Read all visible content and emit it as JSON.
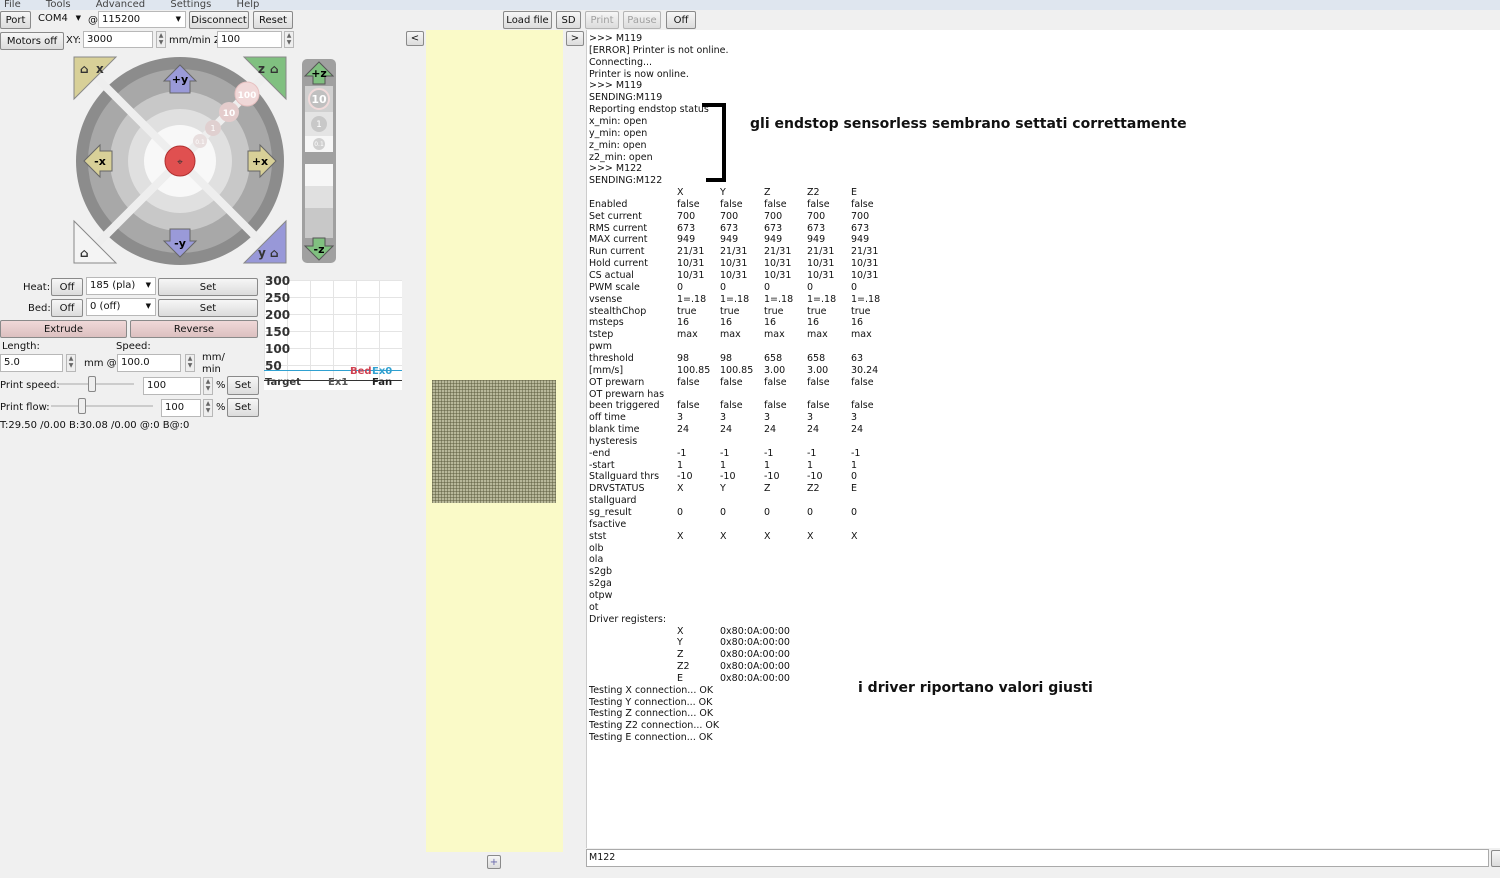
{
  "menu": [
    "File",
    "Tools",
    "Advanced",
    "Settings",
    "Help"
  ],
  "toolbar": {
    "port": "Port",
    "com": "COM4",
    "at": "@",
    "baud": "115200",
    "disconnect": "Disconnect",
    "reset": "Reset",
    "motors_off": "Motors off",
    "xy_label": "XY:",
    "xy_value": "3000",
    "mmmin_z": "mm/min Z:",
    "z_value": "100",
    "load_file": "Load file",
    "sd": "SD",
    "print": "Print",
    "pause": "Pause",
    "off": "Off",
    "collapse_left": "<",
    "collapse_right": ">",
    "add": "+"
  },
  "jog": {
    "home_x": "x",
    "home_z": "z",
    "home_y": "y",
    "plus_y": "+y",
    "minus_y": "-y",
    "plus_x": "+x",
    "minus_x": "-x",
    "plus_z": "+z",
    "minus_z": "-z",
    "steps": [
      "100",
      "10",
      "1",
      "0.1"
    ],
    "z_steps": [
      "10",
      "1",
      "0.1"
    ]
  },
  "temps": {
    "heat_label": "Heat:",
    "bed_label": "Bed:",
    "off": "Off",
    "heat_value": "185 (pla)",
    "bed_value": "0 (off)",
    "set": "Set",
    "extrude": "Extrude",
    "reverse": "Reverse",
    "length_label": "Length:",
    "speed_label": "Speed:",
    "length": "5.0",
    "mm_at": "mm @",
    "speed": "100.0",
    "mm_min": "mm/ min",
    "print_speed_label": "Print speed:",
    "print_speed": "100",
    "print_flow_label": "Print flow:",
    "print_flow": "100",
    "percent": "%",
    "status": "T:29.50 /0.00 B:30.08 /0.00 @:0 B@:0",
    "print_speed_frac": 0.45,
    "print_flow_frac": 0.3
  },
  "graph": {
    "yticks": [
      "300",
      "250",
      "200",
      "150",
      "100",
      "50"
    ],
    "legend_top": [
      "Bed",
      "Ex0"
    ],
    "legend_bottom": [
      "Target",
      "Ex1",
      "Fan"
    ],
    "colors": {
      "bed": "#d04050",
      "ex0": "#30a0d0"
    }
  },
  "console": {
    "lines": [
      ">>> M119",
      "[ERROR] Printer is not online.",
      "Connecting...",
      "Printer is now online.",
      ">>> M119",
      "SENDING:M119",
      "Reporting endstop status",
      "x_min: open",
      "y_min: open",
      "z_min: open",
      "z2_min: open",
      ">>> M122",
      "SENDING:M122"
    ],
    "table": [
      [
        "",
        "X",
        "Y",
        "Z",
        "Z2",
        "E"
      ],
      [
        "Enabled",
        "false",
        "false",
        "false",
        "false",
        "false"
      ],
      [
        "Set current",
        "700",
        "700",
        "700",
        "700",
        "700"
      ],
      [
        "RMS current",
        "673",
        "673",
        "673",
        "673",
        "673"
      ],
      [
        "MAX current",
        "949",
        "949",
        "949",
        "949",
        "949"
      ],
      [
        "Run current",
        "21/31",
        "21/31",
        "21/31",
        "21/31",
        "21/31"
      ],
      [
        "Hold current",
        "10/31",
        "10/31",
        "10/31",
        "10/31",
        "10/31"
      ],
      [
        "CS actual",
        "10/31",
        "10/31",
        "10/31",
        "10/31",
        "10/31"
      ],
      [
        "PWM scale",
        "0",
        "0",
        "0",
        "0",
        "0"
      ],
      [
        "vsense",
        "1=.18",
        "1=.18",
        "1=.18",
        "1=.18",
        "1=.18"
      ],
      [
        "stealthChop",
        "true",
        "true",
        "true",
        "true",
        "true"
      ],
      [
        "msteps",
        "16",
        "16",
        "16",
        "16",
        "16"
      ],
      [
        "tstep",
        "max",
        "max",
        "max",
        "max",
        "max"
      ],
      [
        "pwm"
      ],
      [
        "threshold",
        "98",
        "98",
        "658",
        "658",
        "63"
      ],
      [
        "[mm/s]",
        "100.85",
        "100.85",
        "3.00",
        "3.00",
        "30.24"
      ],
      [
        "OT prewarn",
        "false",
        "false",
        "false",
        "false",
        "false"
      ],
      [
        "OT prewarn has"
      ],
      [
        "been triggered",
        "false",
        "false",
        "false",
        "false",
        "false"
      ],
      [
        "off time",
        "3",
        "3",
        "3",
        "3",
        "3"
      ],
      [
        "blank time",
        "24",
        "24",
        "24",
        "24",
        "24"
      ],
      [
        "hysteresis"
      ],
      [
        "-end",
        "-1",
        "-1",
        "-1",
        "-1",
        "-1"
      ],
      [
        "-start",
        "1",
        "1",
        "1",
        "1",
        "1"
      ],
      [
        "Stallguard thrs",
        "-10",
        "-10",
        "-10",
        "-10",
        "0"
      ],
      [
        "DRVSTATUS",
        "X",
        "Y",
        "Z",
        "Z2",
        "E"
      ],
      [
        "stallguard"
      ],
      [
        "sg_result",
        "0",
        "0",
        "0",
        "0",
        "0"
      ],
      [
        "fsactive"
      ],
      [
        "stst",
        "X",
        "X",
        "X",
        "X",
        "X"
      ],
      [
        "olb"
      ],
      [
        "ola"
      ],
      [
        "s2gb"
      ],
      [
        "s2ga"
      ],
      [
        "otpw"
      ],
      [
        "ot"
      ],
      [
        "Driver registers:"
      ],
      [
        "",
        "X",
        "0x80:0A:00:00"
      ],
      [
        "",
        "Y",
        "0x80:0A:00:00"
      ],
      [
        "",
        "Z",
        "0x80:0A:00:00"
      ],
      [
        "",
        "Z2",
        "0x80:0A:00:00"
      ],
      [
        "",
        "E",
        "0x80:0A:00:00"
      ],
      [
        "Testing X connection... OK"
      ],
      [
        "Testing Y connection... OK"
      ],
      [
        "Testing Z connection... OK"
      ],
      [
        "Testing Z2 connection... OK"
      ],
      [
        "Testing E connection... OK"
      ]
    ],
    "command": "M122"
  },
  "annotations": [
    "gli endstop sensorless sembrano settati correttamente",
    "i driver riportano valori giusti"
  ]
}
